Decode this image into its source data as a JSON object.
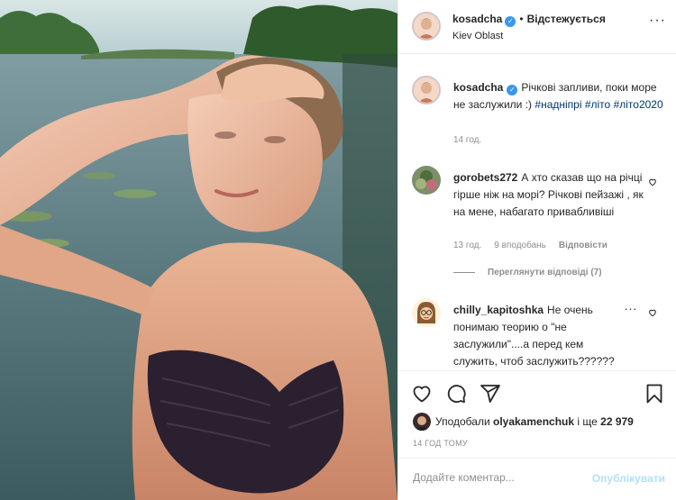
{
  "post": {
    "username": "kosadcha",
    "follow_status": "Відстежується",
    "location": "Kiev Oblast"
  },
  "caption": {
    "username": "kosadcha",
    "text": "Річкові запливи, поки море не заслужили :)",
    "hashtags": [
      "#наднiпрi",
      "#лiто",
      "#лiто2020"
    ],
    "time": "14 год."
  },
  "comments": [
    {
      "username": "gorobets272",
      "text": "А хто сказав що на річці гірше ніж на морі? Річкові пейзажі , як на мене, набагато привабливіші",
      "time": "13 год.",
      "likes": "9 вподобань",
      "reply_label": "Відповісти",
      "view_replies": "Переглянути відповіді (7)"
    },
    {
      "username": "chilly_kapitoshka",
      "text": "Не очень понимаю теорию о \"не заслужили\"....а перед кем служить, чтоб заслужить??????"
    }
  ],
  "likes": {
    "prefix": "Уподобали",
    "user": "olyakamenchuk",
    "middle": "і ще",
    "count": "22 979"
  },
  "post_time": "14 ГОД ТОМУ",
  "add_comment": {
    "placeholder": "Додайте коментар...",
    "post_label": "Опублікувати"
  },
  "colors": {
    "link": "#00376b",
    "verified": "#3897f0",
    "post_disabled": "#b2dffc",
    "muted": "#8e8e8e"
  },
  "icons": [
    "verified-badge-icon",
    "more-options-icon",
    "heart-icon",
    "comment-icon",
    "share-icon",
    "bookmark-icon"
  ]
}
